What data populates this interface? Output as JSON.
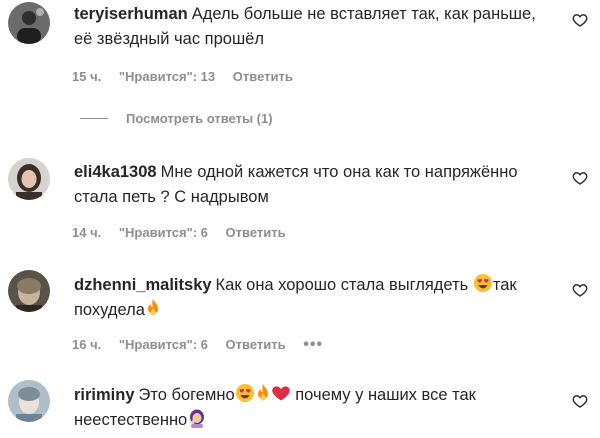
{
  "comments": [
    {
      "username": "teryiserhuman",
      "text_line1": "Адель больше не вставляет так, как раньше,",
      "text_line2": "её звёздный час прошёл",
      "time": "15 ч.",
      "likes": "\"Нравится\": 13",
      "reply": "Ответить",
      "view_replies": "Посмотреть ответы (1)"
    },
    {
      "username": "eli4ka1308",
      "text_line1": "Мне одной кажется что она как то напряжённо",
      "text_line2": "стала петь ? С надрывом",
      "time": "14 ч.",
      "likes": "\"Нравится\": 6",
      "reply": "Ответить"
    },
    {
      "username": "dzhenni_malitsky",
      "text_line1": "Как она хорошо стала выглядеть",
      "text_line1b": "так",
      "text_line2": "похудела",
      "time": "16 ч.",
      "likes": "\"Нравится\": 6",
      "reply": "Ответить",
      "more": "•••"
    },
    {
      "username": "ririminy",
      "text_line1": "Это богемно",
      "text_line1b": "почему у наших все так",
      "text_line2": "неестественно"
    }
  ]
}
